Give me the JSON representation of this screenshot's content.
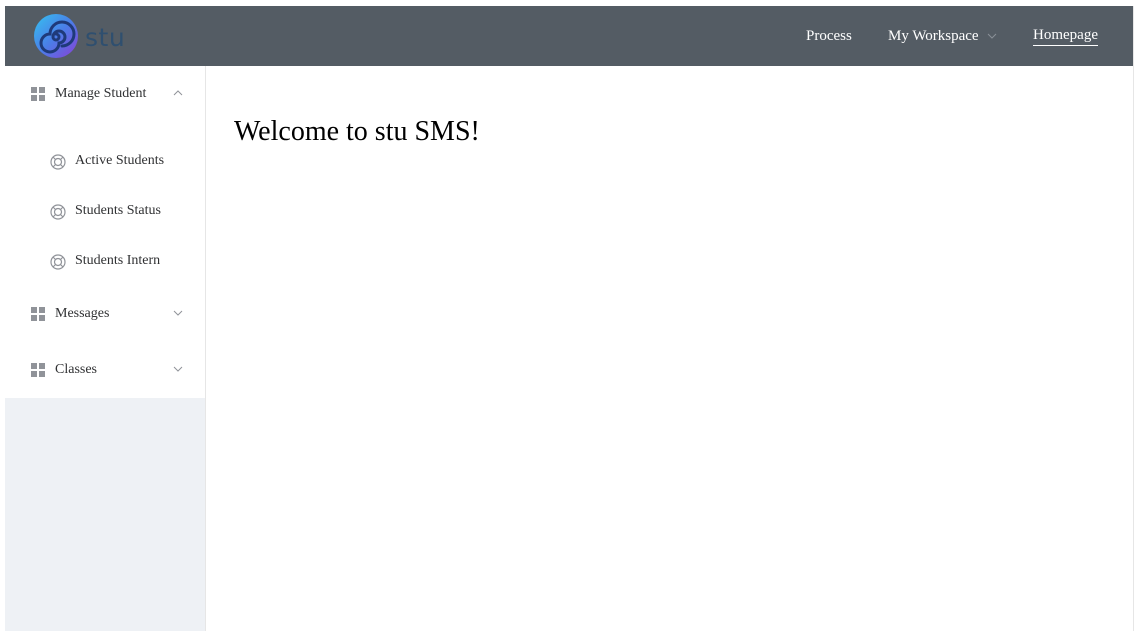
{
  "header": {
    "logo_text": "stu",
    "nav": {
      "process": "Process",
      "workspace": "My Workspace",
      "homepage": "Homepage"
    }
  },
  "sidebar": {
    "groups": [
      {
        "label": "Manage Student",
        "expanded": true,
        "items": [
          {
            "label": "Active Students"
          },
          {
            "label": "Students Status"
          },
          {
            "label": "Students Intern"
          }
        ]
      },
      {
        "label": "Messages",
        "expanded": false
      },
      {
        "label": "Classes",
        "expanded": false
      }
    ]
  },
  "main": {
    "welcome": "Welcome to stu SMS!"
  },
  "colors": {
    "topbar": "#545c64",
    "sidebar_bg": "#eef1f5",
    "icon_gray": "#909399"
  }
}
